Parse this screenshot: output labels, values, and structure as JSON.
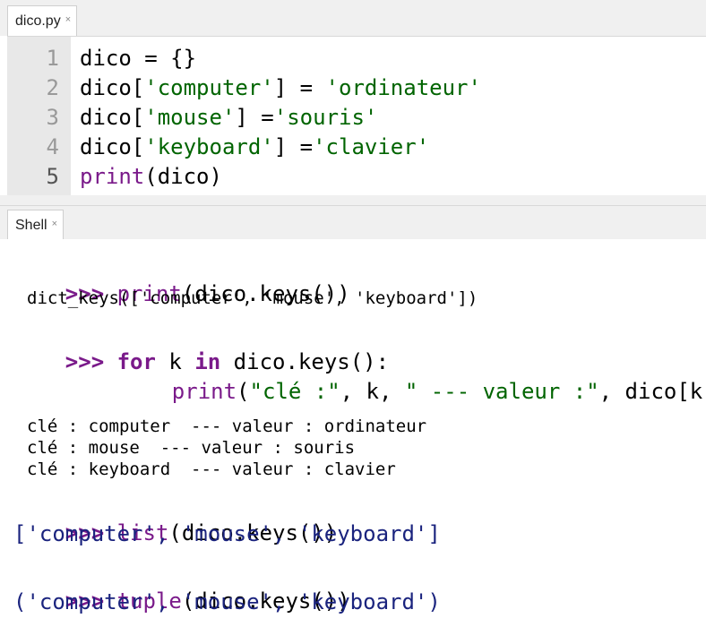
{
  "editor_tab": {
    "title": "dico.py",
    "close": "×"
  },
  "shell_tab": {
    "title": "Shell",
    "close": "×"
  },
  "editor": {
    "lines": [
      {
        "num": "1",
        "parts": [
          {
            "t": "dico = {}",
            "c": ""
          }
        ]
      },
      {
        "num": "2",
        "parts": [
          {
            "t": "dico[",
            "c": ""
          },
          {
            "t": "'computer'",
            "c": "str"
          },
          {
            "t": "] = ",
            "c": ""
          },
          {
            "t": "'ordinateur'",
            "c": "str"
          }
        ]
      },
      {
        "num": "3",
        "parts": [
          {
            "t": "dico[",
            "c": ""
          },
          {
            "t": "'mouse'",
            "c": "str"
          },
          {
            "t": "] =",
            "c": ""
          },
          {
            "t": "'souris'",
            "c": "str"
          }
        ]
      },
      {
        "num": "4",
        "parts": [
          {
            "t": "dico[",
            "c": ""
          },
          {
            "t": "'keyboard'",
            "c": "str"
          },
          {
            "t": "] =",
            "c": ""
          },
          {
            "t": "'clavier'",
            "c": "str"
          }
        ]
      },
      {
        "num": "5",
        "parts": [
          {
            "t": "print",
            "c": "bi"
          },
          {
            "t": "(dico)",
            "c": ""
          }
        ]
      }
    ]
  },
  "shell": {
    "prompt": ">>>",
    "cmd1": {
      "fn": "print",
      "rest": "(dico.keys())"
    },
    "out1": "dict_keys(['computer', 'mouse', 'keyboard'])",
    "cmd2": {
      "kw_for": "for",
      "var": " k ",
      "kw_in": "in",
      "rest": " dico.keys():"
    },
    "cmd2_body": {
      "fn": "print",
      "open": "(",
      "s1": "\"clé :\"",
      "mid": ", k, ",
      "s2": "\" --- valeur :\"",
      "end": ", dico[k])"
    },
    "out2": [
      "clé : computer  --- valeur : ordinateur",
      "clé : mouse  --- valeur : souris",
      "clé : keyboard  --- valeur : clavier"
    ],
    "cmd3": {
      "fn": "list",
      "rest": "(dico.keys())"
    },
    "res3": "['computer', 'mouse', 'keyboard']",
    "cmd4": {
      "fn": "tuple",
      "rest": "(dico.keys())"
    },
    "res4": "('computer', 'mouse', 'keyboard')"
  }
}
